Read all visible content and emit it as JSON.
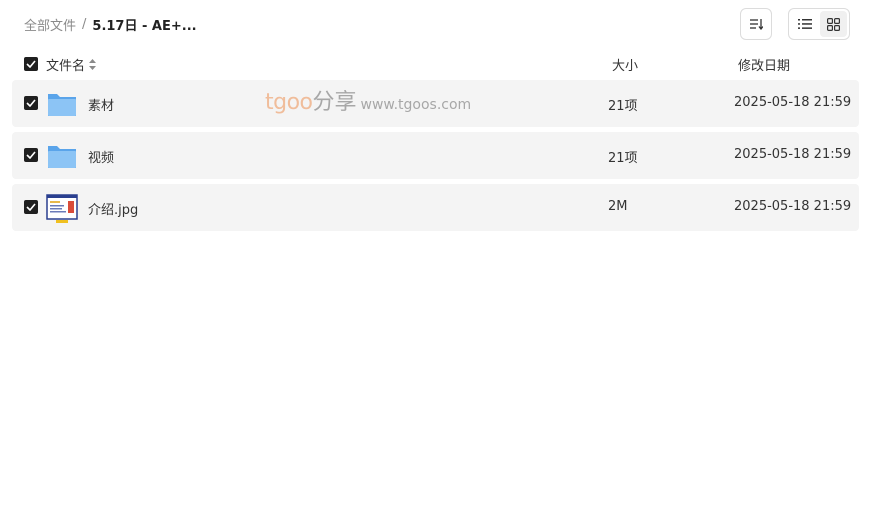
{
  "breadcrumb": {
    "root": "全部文件",
    "separator": "/",
    "current": "5.17日 - AE+..."
  },
  "toolbar": {
    "sort_icon": "sort-icon",
    "view_list_icon": "list-view-icon",
    "view_grid_icon": "grid-view-icon"
  },
  "header": {
    "name": "文件名",
    "size": "大小",
    "date": "修改日期"
  },
  "files": [
    {
      "name": "素材",
      "size": "21项",
      "date": "2025-05-18 21:59",
      "icon": "folder-icon",
      "checked": true
    },
    {
      "name": "视频",
      "size": "21项",
      "date": "2025-05-18 21:59",
      "icon": "folder-icon",
      "checked": true
    },
    {
      "name": "介绍.jpg",
      "size": "2M",
      "date": "2025-05-18 21:59",
      "icon": "image-file-icon",
      "checked": true
    }
  ],
  "watermark": {
    "brand": "tgoo",
    "cn": "分享",
    "url": "www.tgoos.com"
  },
  "colors": {
    "row_bg": "#f4f4f4",
    "checkbox": "#1f1f1f",
    "folder": "#7db8f0"
  }
}
